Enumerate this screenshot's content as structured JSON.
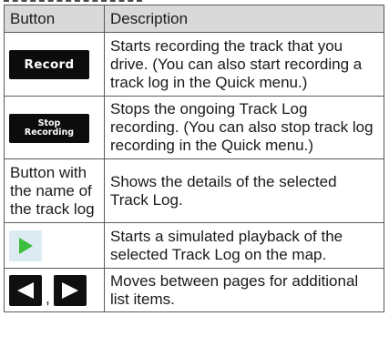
{
  "table": {
    "headers": {
      "button": "Button",
      "description": "Description"
    },
    "rows": [
      {
        "button_label": "Record",
        "description": "Starts recording the track that you drive. (You can also start recording a track log in the Quick menu.)"
      },
      {
        "button_label_line1": "Stop",
        "button_label_line2": "Recording",
        "description": "Stops the ongoing Track Log recording. (You can also stop track log recording in the Quick menu.)"
      },
      {
        "button_text": "Button with the name of the track log",
        "description": "Shows the details of the selected Track Log."
      },
      {
        "icon": "play-icon",
        "description": "Starts a simulated playback of the selected Track Log on the map."
      },
      {
        "icons": [
          "left-arrow-icon",
          "right-arrow-icon"
        ],
        "separator": ",",
        "description": "Moves between pages for additional list items."
      }
    ]
  },
  "colors": {
    "header_bg": "#d9d9d9",
    "border": "#5a5a5a",
    "button_bg": "#0c0c0c",
    "play_tile_bg": "#dcebf2",
    "play_green": "#3cbf3c"
  }
}
